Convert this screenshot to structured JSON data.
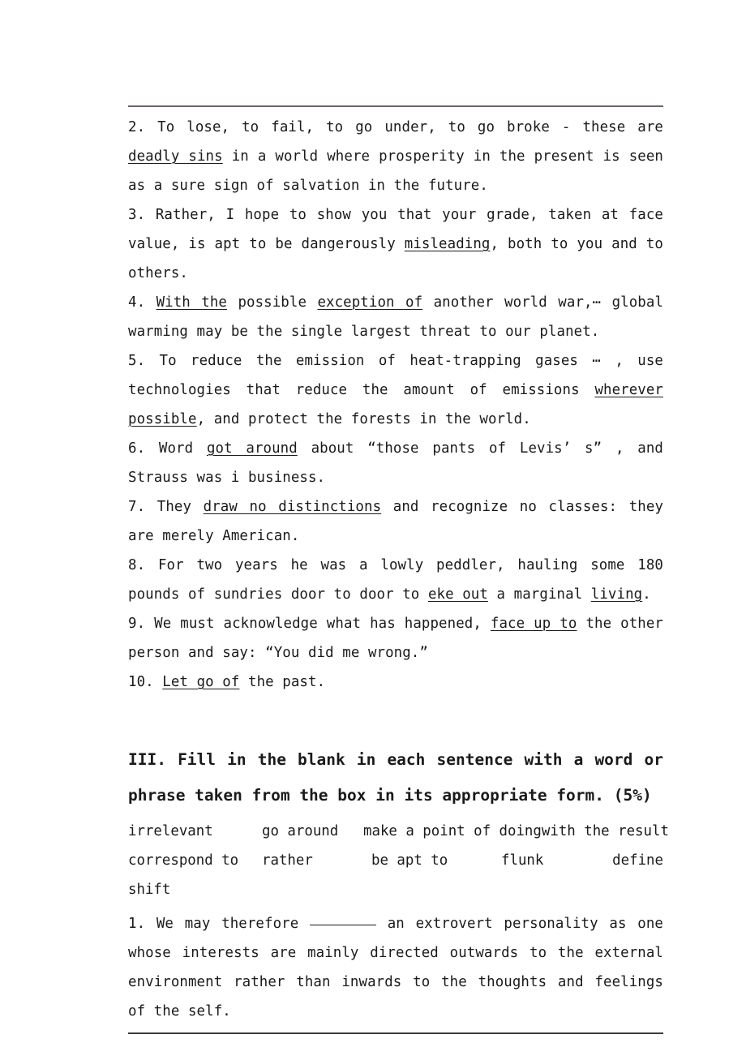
{
  "document": {
    "rules": {
      "top": "horizontal-rule",
      "bottom": "horizontal-rule"
    },
    "translation_items": [
      {
        "number": "2.",
        "text_before": " To lose, to fail, to go under, to go broke - these are ",
        "underlined": "deadly sins",
        "text_after": " in a world where prosperity in the present is seen as a sure sign of salvation in the future."
      },
      {
        "number": "3.",
        "text_before": " Rather, I hope to show you that your grade, taken at face value, is apt to be dangerously ",
        "underlined": "misleading",
        "text_after": ", both to you and to others."
      },
      {
        "number": "4.",
        "text_before": " ",
        "underlined": "With the",
        "text_mid": " possible ",
        "underlined2": "exception of",
        "text_after": " another world war,⋯ global warming may be the single largest threat to our planet."
      },
      {
        "number": "5.",
        "text_before": " To reduce the emission of heat-trapping gases ⋯ , use technologies that reduce the amount of emissions ",
        "underlined": "wherever possible",
        "text_after": ", and protect the forests in the world."
      },
      {
        "number": "6.",
        "text_before": " Word ",
        "underlined": "got around",
        "text_after": " about “those pants of Levis’ s” , and Strauss was i business."
      },
      {
        "number": "7.",
        "text_before": " They ",
        "underlined": "draw no distinctions",
        "text_after": " and recognize no classes: they are merely American."
      },
      {
        "number": "8.",
        "text_before": " For two years he was a lowly peddler, hauling some 180 pounds of sundries door to door to ",
        "underlined": "eke out",
        "text_mid": " a marginal ",
        "underlined2": "living",
        "text_after": "."
      },
      {
        "number": "9.",
        "text_before": " We must acknowledge what has happened, ",
        "underlined": "face up to",
        "text_after": " the other person and say: “You did me wrong.”"
      },
      {
        "number": "10.",
        "text_before": " ",
        "underlined": "Let go of",
        "text_after": " the past."
      }
    ],
    "section_three": {
      "heading": "III. Fill in the blank in each sentence with a word or phrase taken from the box in its appropriate form. (5%)",
      "word_box": {
        "row1": [
          "irrelevant",
          "go around",
          "make a point of doing",
          "with the result"
        ],
        "row2": [
          "correspond to",
          "rather",
          "be apt to",
          "flunk",
          "define"
        ],
        "row3": [
          "shift"
        ]
      },
      "questions": [
        {
          "number": "1.",
          "text_before": " We may therefore ",
          "blank": "__________",
          "text_after": " an extrovert personality as one whose interests are mainly directed outwards to the external environment rather than inwards to the thoughts and feelings of the self."
        }
      ]
    }
  }
}
